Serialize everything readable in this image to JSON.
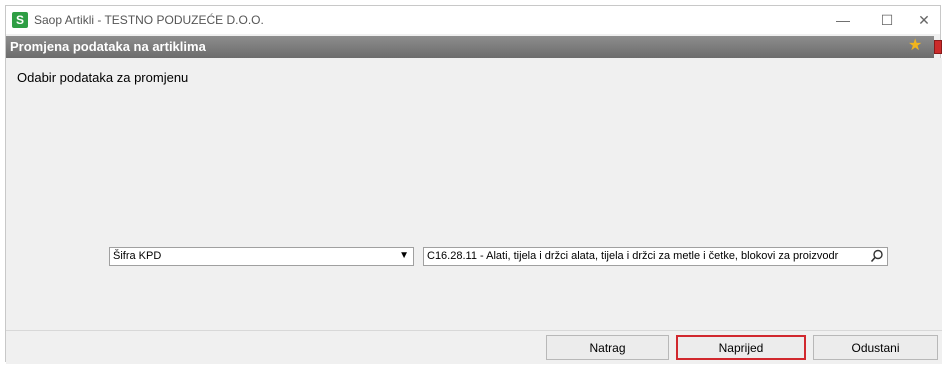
{
  "window": {
    "app_icon_letter": "S",
    "title": "Saop Artikli - TESTNO PODUZEĆE D.O.O.",
    "controls": {
      "minimize": "—",
      "maximize": "☐",
      "close": "✕"
    }
  },
  "header": {
    "title": "Promjena podataka na artiklima"
  },
  "main": {
    "section_title": "Odabir podataka za promjenu",
    "field_select": {
      "selected": "Šifra KPD"
    },
    "field_value": {
      "value": "C16.28.11 - Alati, tijela i držci alata, tijela i držci za metle i četke, blokovi za proizvodr"
    }
  },
  "footer": {
    "back_label": "Natrag",
    "next_label": "Naprijed",
    "cancel_label": "Odustani"
  },
  "colors": {
    "header_bg": "#7a7a7a",
    "app_icon": "#2e9e44",
    "focus_border": "#d1282e",
    "star": "#f2b51d"
  }
}
